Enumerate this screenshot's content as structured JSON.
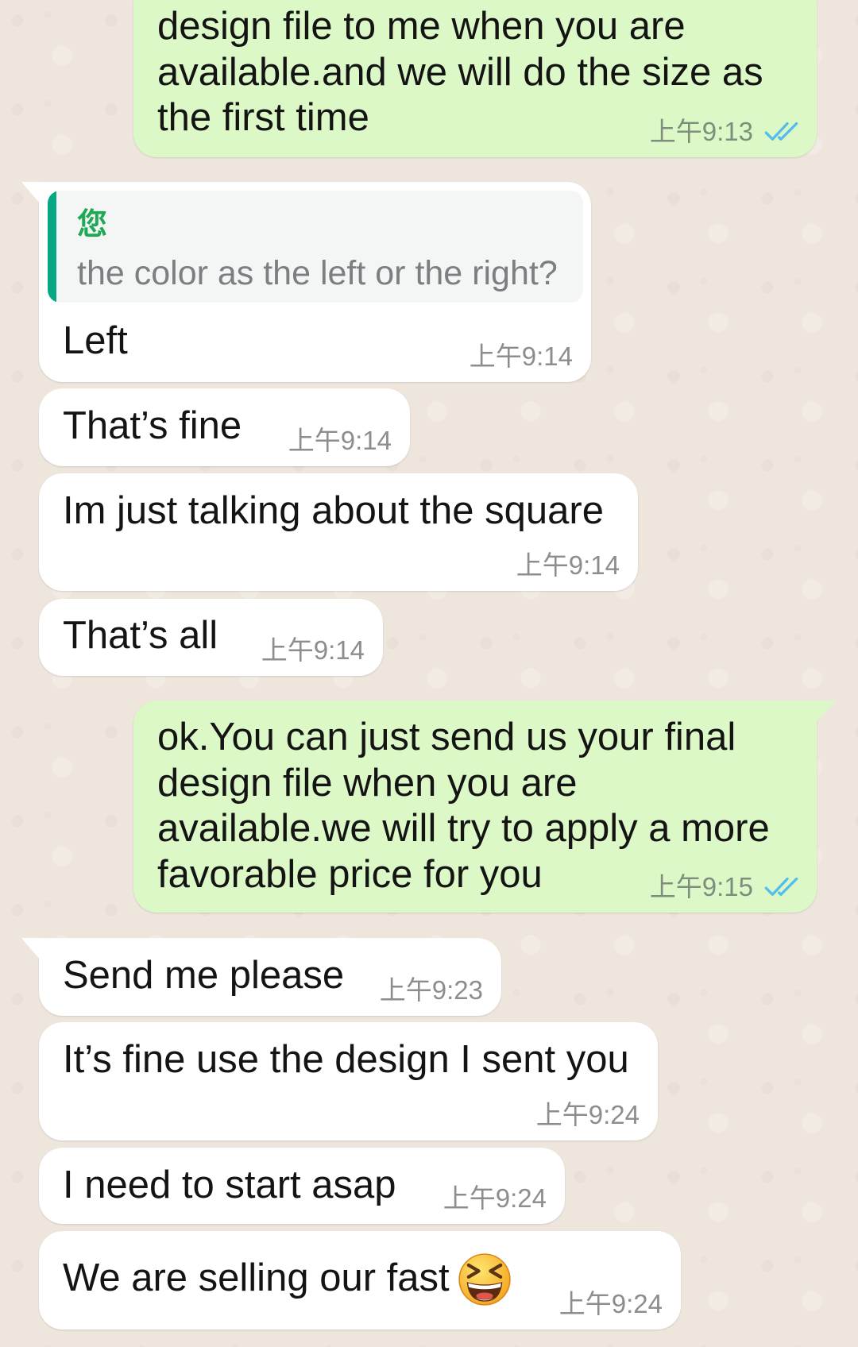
{
  "theme": {
    "background": "#eee6dd",
    "read_receipt": "#53bdeb",
    "quote_bar": "#06a884",
    "quote_author": "#1fa855"
  },
  "messages": [
    {
      "bubble_color": "#dcf8c6",
      "lines": [
        "design file to me when you are",
        "available.and we will do the size as",
        "the first time"
      ],
      "time": "上午9:13",
      "status_icon": "double-check-read-icon"
    },
    {
      "bubble_color": "#ffffff",
      "tail": true,
      "quote": {
        "author": "您",
        "text": "the color as the left or the right?"
      },
      "lines": [
        "Left"
      ],
      "time": "上午9:14"
    },
    {
      "bubble_color": "#ffffff",
      "lines": [
        "That’s fine"
      ],
      "time": "上午9:14"
    },
    {
      "bubble_color": "#ffffff",
      "lines": [
        "Im just talking about the square"
      ],
      "time": "上午9:14"
    },
    {
      "bubble_color": "#ffffff",
      "lines": [
        "That’s all"
      ],
      "time": "上午9:14"
    },
    {
      "bubble_color": "#dcf8c6",
      "tail": true,
      "lines": [
        "ok.You can just send us your final",
        "design file when you are",
        "available.we will try to apply a more",
        "favorable price for you"
      ],
      "time": "上午9:15",
      "status_icon": "double-check-read-icon"
    },
    {
      "bubble_color": "#ffffff",
      "tail": true,
      "lines": [
        "Send me please"
      ],
      "time": "上午9:23"
    },
    {
      "bubble_color": "#ffffff",
      "lines": [
        "It’s fine use the design I sent you"
      ],
      "time": "上午9:24"
    },
    {
      "bubble_color": "#ffffff",
      "lines": [
        "I need to start asap"
      ],
      "time": "上午9:24"
    },
    {
      "bubble_color": "#ffffff",
      "lines": [
        "We are selling our fast"
      ],
      "emoji": "grinning-squinting-face-icon",
      "time": "上午9:24"
    }
  ]
}
